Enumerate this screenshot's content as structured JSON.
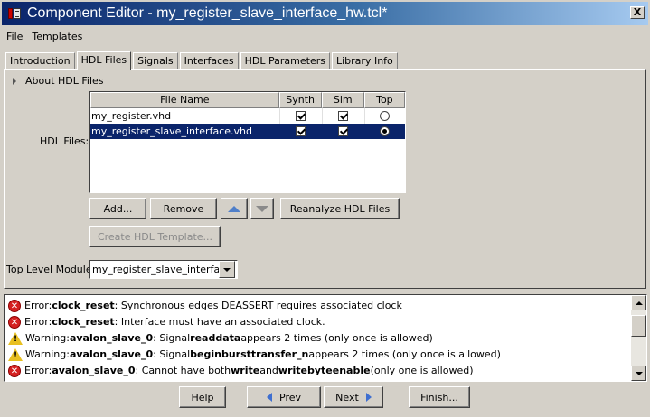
{
  "window": {
    "title": "Component Editor - my_register_slave_interface_hw.tcl*",
    "close_label": "X"
  },
  "menu": [
    "File",
    "Templates"
  ],
  "tabs": [
    "Introduction",
    "HDL Files",
    "Signals",
    "Interfaces",
    "HDL Parameters",
    "Library Info"
  ],
  "active_tab": "HDL Files",
  "about_section": "About HDL Files",
  "hdl_files_label": "HDL Files:",
  "table": {
    "headers": [
      "File Name",
      "Synth",
      "Sim",
      "Top"
    ],
    "rows": [
      {
        "file": "my_register.vhd",
        "synth": true,
        "sim": true,
        "top": false,
        "selected": false
      },
      {
        "file": "my_register_slave_interface.vhd",
        "synth": true,
        "sim": true,
        "top": true,
        "selected": true
      }
    ]
  },
  "buttons": {
    "add": "Add...",
    "remove": "Remove",
    "reanalyze": "Reanalyze HDL Files",
    "create_template": "Create HDL Template..."
  },
  "top_level": {
    "label": "Top Level Module:",
    "value": "my_register_slave_interface"
  },
  "messages": [
    {
      "type": "error",
      "prefix": "Error: ",
      "parts": [
        [
          "b",
          "clock_reset"
        ],
        [
          "t",
          ": Synchronous edges DEASSERT requires associated clock"
        ]
      ]
    },
    {
      "type": "error",
      "prefix": "Error: ",
      "parts": [
        [
          "b",
          "clock_reset"
        ],
        [
          "t",
          ": Interface must have an associated clock."
        ]
      ]
    },
    {
      "type": "warning",
      "prefix": "Warning: ",
      "parts": [
        [
          "b",
          "avalon_slave_0"
        ],
        [
          "t",
          ": Signal "
        ],
        [
          "b",
          "readdata"
        ],
        [
          "t",
          " appears 2 times (only once is allowed)"
        ]
      ]
    },
    {
      "type": "warning",
      "prefix": "Warning: ",
      "parts": [
        [
          "b",
          "avalon_slave_0"
        ],
        [
          "t",
          ": Signal "
        ],
        [
          "b",
          "beginbursttransfer_n"
        ],
        [
          "t",
          " appears 2 times (only once is allowed)"
        ]
      ]
    },
    {
      "type": "error",
      "prefix": "Error: ",
      "parts": [
        [
          "b",
          "avalon_slave_0"
        ],
        [
          "t",
          ": Cannot have both "
        ],
        [
          "b",
          "write"
        ],
        [
          "t",
          " and "
        ],
        [
          "b",
          "writebyteenable"
        ],
        [
          "t",
          " (only one is allowed)"
        ]
      ]
    }
  ],
  "footer": {
    "help": "Help",
    "prev": "Prev",
    "next": "Next",
    "finish": "Finish..."
  },
  "icons": {
    "error": "error-icon",
    "warning": "warning-icon"
  },
  "colors": {
    "selection": "#0a246a",
    "error": "#d42020",
    "warning": "#e8c020"
  }
}
